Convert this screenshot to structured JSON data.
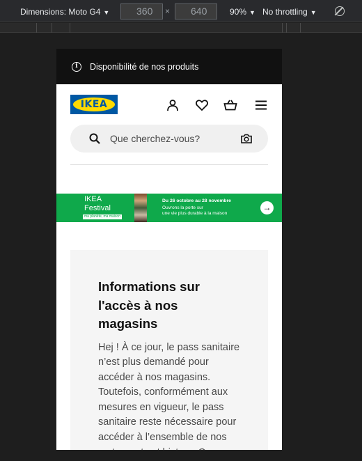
{
  "devtools": {
    "device_label": "Dimensions: Moto G4",
    "width": "360",
    "height": "640",
    "times": "×",
    "zoom": "90%",
    "throttling": "No throttling"
  },
  "page": {
    "topbar_text": "Disponibilité de nos produits",
    "logo_text": "IKEA",
    "search_placeholder": "Que cherchez-vous?",
    "banner": {
      "title_line1": "IKEA",
      "title_line2": "Festival",
      "tag": "ma planète, ma maison",
      "dates": "Du 26 octobre au 28 novembre",
      "line1": "Ouvrons la porte sur",
      "line2": "une vie plus durable à la maison",
      "arrow": "→"
    },
    "card": {
      "title": "Informations sur l'accès à nos magasins",
      "body": "Hej ! À ce jour, le pass sanitaire n’est plus demandé pour accéder à nos magasins. Toutefois, conformément aux mesures en vigueur, le pass sanitaire reste nécessaire pour accéder à l’ensemble de nos restaurants et bistros. Or"
    }
  },
  "colors": {
    "brand_blue": "#0058a3",
    "brand_yellow": "#ffdb00",
    "banner_green": "#0fa94b",
    "topbar": "#111111"
  },
  "icons": [
    "info-icon",
    "account-icon",
    "heart-icon",
    "basket-icon",
    "menu-icon",
    "search-icon",
    "camera-icon",
    "arrow-right-icon",
    "rotate-icon"
  ]
}
